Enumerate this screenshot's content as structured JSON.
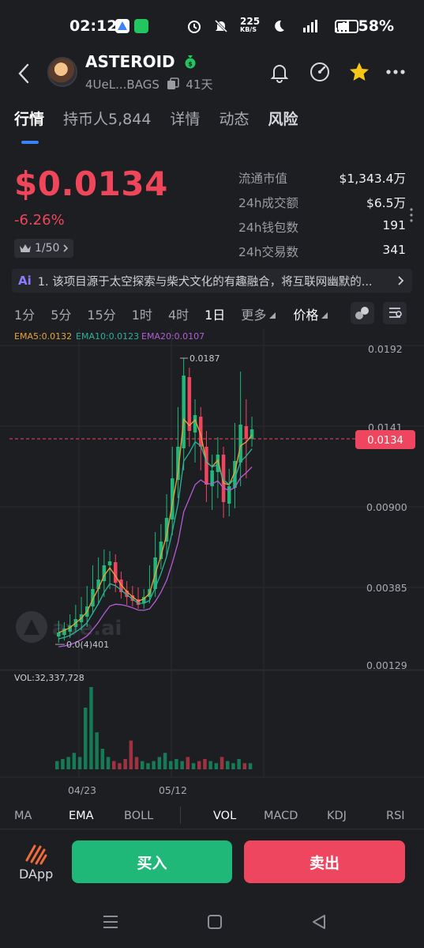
{
  "status_bar": {
    "time": "02:12",
    "net_speed_value": "225",
    "net_speed_unit": "KB/S",
    "battery": "58%"
  },
  "header": {
    "token_name": "ASTEROID",
    "token_address": "4UeL...BAGS",
    "age": "41天"
  },
  "tabs": [
    "行情",
    "持币人5,844",
    "详情",
    "动态",
    "风险"
  ],
  "price": {
    "value": "$0.0134",
    "change": "-6.26%",
    "rank": "1/50"
  },
  "stats": [
    {
      "label": "流通市值",
      "value": "$1,343.4万"
    },
    {
      "label": "24h成交额",
      "value": "$6.5万"
    },
    {
      "label": "24h钱包数",
      "value": "191"
    },
    {
      "label": "24h交易数",
      "value": "341"
    }
  ],
  "ai_banner": {
    "tag": "Ai",
    "text": "1. 该项目源于太空探索与柴犬文化的有趣融合，将互联网幽默的..."
  },
  "intervals": [
    "1分",
    "5分",
    "15分",
    "1时",
    "4时",
    "1日",
    "更多",
    "价格"
  ],
  "chart_data": {
    "type": "candlestick",
    "interval": "1日",
    "ema_legend": [
      {
        "label": "EMA5:0.0132",
        "color": "#e8a33d"
      },
      {
        "label": "EMA10:0.0123",
        "color": "#2bb39a"
      },
      {
        "label": "EMA20:0.0107",
        "color": "#b55cd6"
      }
    ],
    "y_axis": {
      "scale": "log",
      "ticks": [
        "0.0192",
        "0.0141",
        "0.00900",
        "0.00385",
        "0.00129"
      ]
    },
    "current_price_label": "0.0134",
    "high_label": "0.0187",
    "low_label": "0.0(4)401",
    "watermark": "ave.ai",
    "x_labels": [
      "04/23",
      "05/12"
    ],
    "volume_label": "VOL:32,337,728",
    "colors": {
      "up": "#1fb879",
      "down": "#ef4660",
      "bg": "#1d1e22"
    }
  },
  "indicators": [
    "MA",
    "EMA",
    "BOLL",
    "VOL",
    "MACD",
    "KDJ",
    "RSI"
  ],
  "actions": {
    "dapp": "DApp",
    "buy": "买入",
    "sell": "卖出"
  }
}
